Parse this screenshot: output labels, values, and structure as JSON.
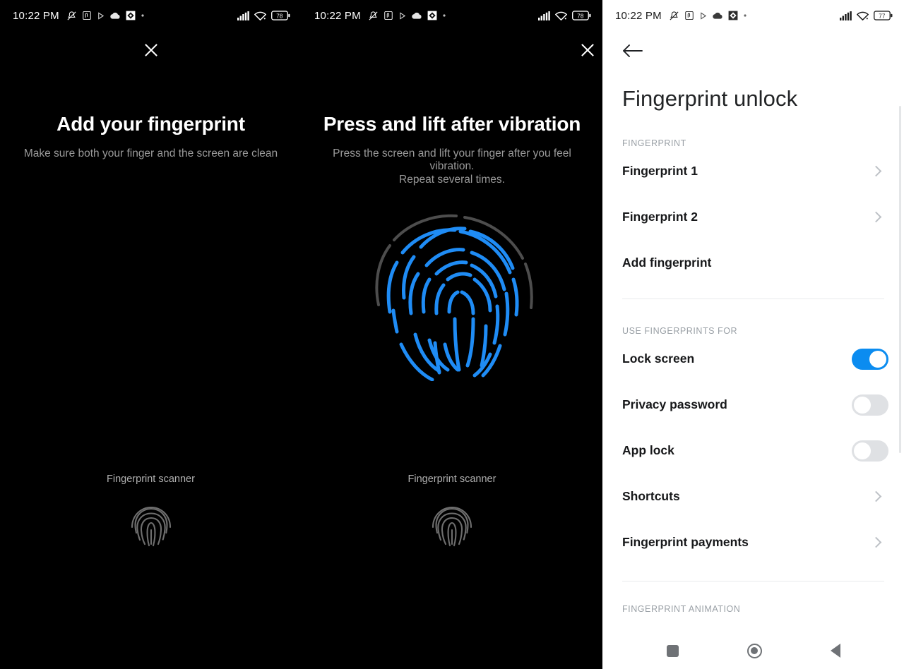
{
  "statusbar": {
    "time": "10:22 PM",
    "icons": [
      "dnd-muted-icon",
      "nfc-icon",
      "play-icon",
      "cloud-icon",
      "app-badge-icon",
      "dot-icon"
    ],
    "right_icons": [
      "cellular-signal-icon",
      "wifi-icon"
    ],
    "battery_dark": "78",
    "battery_light": "77"
  },
  "panel_add": {
    "close_label": "close-icon",
    "title": "Add your fingerprint",
    "subtitle": "Make sure both your finger and the screen are clean",
    "scanner_label": "Fingerprint scanner"
  },
  "panel_press": {
    "close_label": "close-icon",
    "title": "Press and lift after vibration",
    "subtitle_line1": "Press the screen and lift your finger after you feel vibration.",
    "subtitle_line2": "Repeat several times.",
    "scanner_label": "Fingerprint scanner"
  },
  "settings": {
    "back_label": "back-arrow-icon",
    "title": "Fingerprint unlock",
    "section_fingerprint": "FINGERPRINT",
    "fingerprint_items": [
      {
        "label": "Fingerprint 1",
        "chevron": true
      },
      {
        "label": "Fingerprint 2",
        "chevron": true
      },
      {
        "label": "Add fingerprint",
        "chevron": false
      }
    ],
    "section_use_for": "USE FINGERPRINTS FOR",
    "use_for_items": [
      {
        "label": "Lock screen",
        "type": "toggle",
        "state": "on"
      },
      {
        "label": "Privacy password",
        "type": "toggle",
        "state": "off"
      },
      {
        "label": "App lock",
        "type": "toggle",
        "state": "off"
      },
      {
        "label": "Shortcuts",
        "type": "chevron"
      },
      {
        "label": "Fingerprint payments",
        "type": "chevron"
      }
    ],
    "section_animation": "FINGERPRINT ANIMATION"
  },
  "navbar": {
    "recents": "recents-square-icon",
    "home": "home-circle-icon",
    "back": "back-triangle-icon"
  },
  "colors": {
    "accent_blue": "#0b8cf0",
    "print_blue": "#1f8cf5",
    "print_grey": "#4a4a4a",
    "dark_bg": "#000000",
    "light_bg": "#ffffff",
    "section_label": "#9aa0a6"
  }
}
